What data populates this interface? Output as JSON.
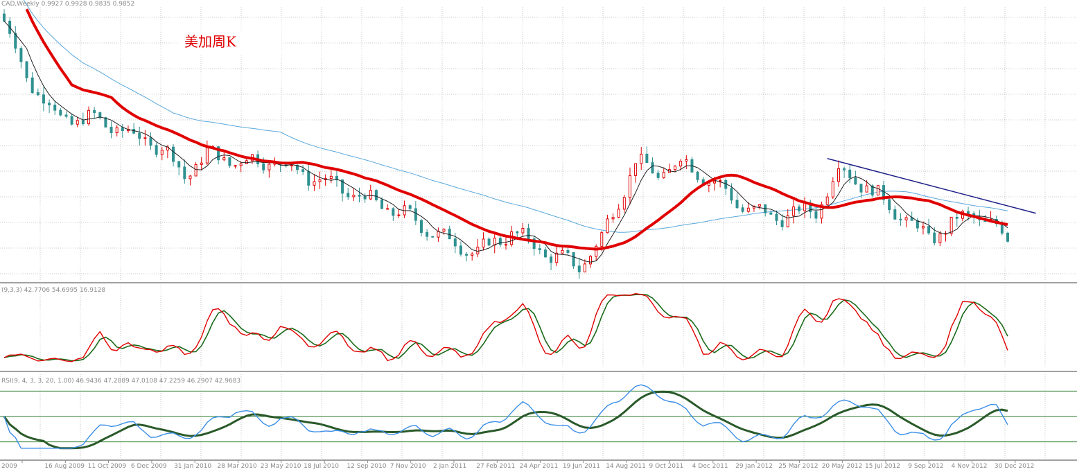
{
  "title": "美加周K",
  "panels": {
    "price": {
      "header": "CAD,Weekly  0.9927 0.9928 0.9835 0.9852"
    },
    "stoch": {
      "header": "(9,3,3) 42.7706 54.6995 16.9128"
    },
    "rsi": {
      "header": "RSI(9, 4, 3, 3, 20, 1.00) 46.9436 47.2889 47.0108 47.2259 46.2907 42.9683"
    }
  },
  "colors": {
    "bull": "#2f9090",
    "bear": "#e00000",
    "ma_red": "#e00000",
    "ma_blue": "#5aa8dc",
    "ma_black": "#202020",
    "trendline": "#20208a",
    "stoch_k": "#e00000",
    "stoch_d": "#1a6a1a",
    "rsi_fast": "#3a8ee8",
    "rsi_slow": "#2a5a2a",
    "grid": "#c8c8c8"
  },
  "chart_data": {
    "type": "candlestick",
    "x_ticks": [
      "2009",
      "16 Aug 2009",
      "11 Oct 2009",
      "6 Dec 2009",
      "31 Jan 2010",
      "28 Mar 2010",
      "23 May 2010",
      "18 Jul 2010",
      "12 Sep 2010",
      "7 Nov 2010",
      "2 Jan 2011",
      "27 Feb 2011",
      "24 Apr 2011",
      "19 Jun 2011",
      "14 Aug 2011",
      "9 Oct 2011",
      "4 Dec 2011",
      "29 Jan 2012",
      "25 Mar 2012",
      "20 May 2012",
      "15 Jul 2012",
      "9 Sep 2012",
      "4 Nov 2012",
      "30 Dec 2012"
    ],
    "price_anchors": [
      {
        "week": 0,
        "value": 1.14
      },
      {
        "week": 4,
        "value": 1.1
      },
      {
        "week": 10,
        "value": 1.07
      },
      {
        "week": 16,
        "value": 1.07
      },
      {
        "week": 22,
        "value": 1.06
      },
      {
        "week": 28,
        "value": 1.05
      },
      {
        "week": 32,
        "value": 1.03
      },
      {
        "week": 36,
        "value": 1.045
      },
      {
        "week": 41,
        "value": 1.04
      },
      {
        "week": 48,
        "value": 1.04
      },
      {
        "week": 54,
        "value": 1.03
      },
      {
        "week": 60,
        "value": 1.02
      },
      {
        "week": 66,
        "value": 1.01
      },
      {
        "week": 72,
        "value": 1.0
      },
      {
        "week": 78,
        "value": 0.985
      },
      {
        "week": 84,
        "value": 0.975
      },
      {
        "week": 90,
        "value": 0.99
      },
      {
        "week": 96,
        "value": 0.975
      },
      {
        "week": 102,
        "value": 0.965
      },
      {
        "week": 106,
        "value": 0.985
      },
      {
        "week": 112,
        "value": 1.04
      },
      {
        "week": 116,
        "value": 1.03
      },
      {
        "week": 120,
        "value": 1.04
      },
      {
        "week": 126,
        "value": 1.025
      },
      {
        "week": 130,
        "value": 1.01
      },
      {
        "week": 136,
        "value": 1.0
      },
      {
        "week": 144,
        "value": 1.005
      },
      {
        "week": 148,
        "value": 1.035
      },
      {
        "week": 152,
        "value": 1.025
      },
      {
        "week": 158,
        "value": 1.005
      },
      {
        "week": 164,
        "value": 0.985
      },
      {
        "week": 168,
        "value": 0.995
      },
      {
        "week": 172,
        "value": 1.003
      },
      {
        "week": 176,
        "value": 0.992
      },
      {
        "week": 178,
        "value": 0.985
      }
    ],
    "y_range": [
      0.955,
      1.15
    ],
    "weeks": 179,
    "series": [
      {
        "name": "",
        "type": "candles"
      },
      {
        "name": "",
        "type": "ma"
      },
      {
        "name": "",
        "type": "ma"
      },
      {
        "name": "",
        "type": "ma"
      }
    ],
    "stochastic": {
      "range": [
        0,
        100
      ]
    },
    "rsi": {
      "range": [
        0,
        100
      ],
      "levels": [
        80,
        50,
        20
      ]
    },
    "grid": true,
    "trendline": {
      "from": {
        "week": 146,
        "value": 1.042
      },
      "to": {
        "week": 183,
        "value": 1.003
      }
    }
  }
}
